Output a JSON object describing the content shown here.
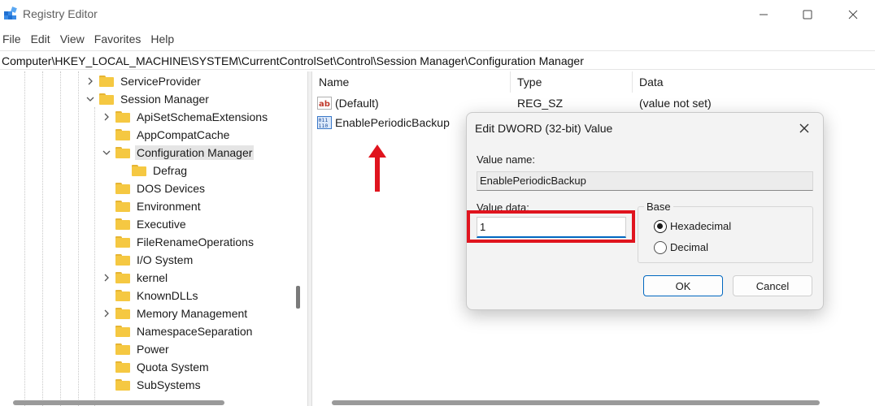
{
  "window": {
    "title": "Registry Editor",
    "controls": {
      "minimize_icon": "minimize-icon",
      "maximize_icon": "maximize-icon",
      "close_icon": "close-icon"
    }
  },
  "menu": [
    "File",
    "Edit",
    "View",
    "Favorites",
    "Help"
  ],
  "address": "Computer\\HKEY_LOCAL_MACHINE\\SYSTEM\\CurrentControlSet\\Control\\Session Manager\\Configuration Manager",
  "tree": [
    {
      "label": "ServiceProvider",
      "chevron": "right"
    },
    {
      "label": "Session Manager",
      "chevron": "down"
    },
    {
      "label": "ApiSetSchemaExtensions",
      "chevron": "right"
    },
    {
      "label": "AppCompatCache",
      "chevron": "none"
    },
    {
      "label": "Configuration Manager",
      "chevron": "down",
      "selected": true
    },
    {
      "label": "Defrag",
      "chevron": "none"
    },
    {
      "label": "DOS Devices",
      "chevron": "none"
    },
    {
      "label": "Environment",
      "chevron": "none"
    },
    {
      "label": "Executive",
      "chevron": "none"
    },
    {
      "label": "FileRenameOperations",
      "chevron": "none"
    },
    {
      "label": "I/O System",
      "chevron": "none"
    },
    {
      "label": "kernel",
      "chevron": "right"
    },
    {
      "label": "KnownDLLs",
      "chevron": "none"
    },
    {
      "label": "Memory Management",
      "chevron": "right"
    },
    {
      "label": "NamespaceSeparation",
      "chevron": "none"
    },
    {
      "label": "Power",
      "chevron": "none"
    },
    {
      "label": "Quota System",
      "chevron": "none"
    },
    {
      "label": "SubSystems",
      "chevron": "none"
    }
  ],
  "list": {
    "columns": [
      "Name",
      "Type",
      "Data"
    ],
    "rows": [
      {
        "icon": "string-value-icon",
        "name": "(Default)",
        "type": "REG_SZ",
        "data": "(value not set)"
      },
      {
        "icon": "dword-value-icon",
        "name": "EnablePeriodicBackup",
        "type": "",
        "data": ""
      }
    ]
  },
  "dialog": {
    "title": "Edit DWORD (32-bit) Value",
    "value_name_label": "Value name:",
    "value_name": "EnablePeriodicBackup",
    "value_data_label": "Value data:",
    "value_data": "1",
    "base_label": "Base",
    "base_options": [
      {
        "label": "Hexadecimal",
        "checked": true
      },
      {
        "label": "Decimal",
        "checked": false
      }
    ],
    "ok_label": "OK",
    "cancel_label": "Cancel"
  },
  "colors": {
    "annotation_red": "#e0141e",
    "accent_blue": "#0067c0",
    "folder_yellow": "#f5c842"
  }
}
